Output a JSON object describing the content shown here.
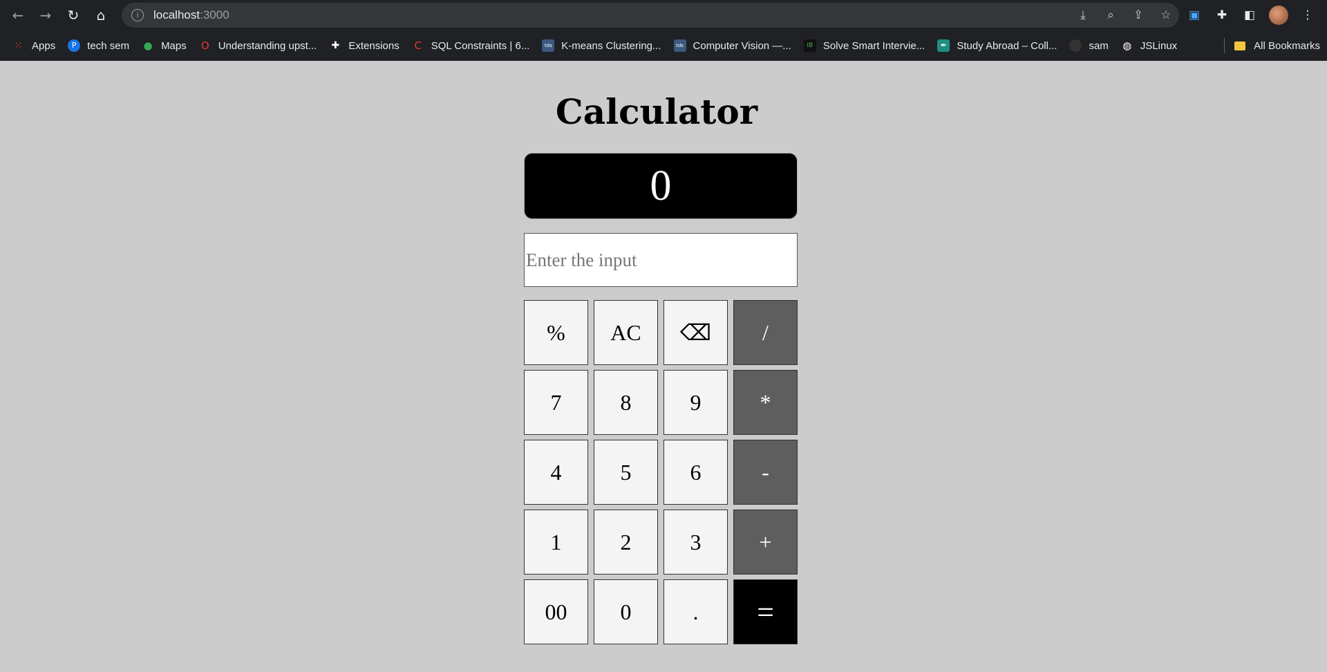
{
  "browser": {
    "url_host": "localhost",
    "url_port": ":3000",
    "bookmarks": [
      {
        "label": "Apps",
        "icon": "apps-grid-icon"
      },
      {
        "label": "tech sem",
        "icon": "p-logo-icon"
      },
      {
        "label": "Maps",
        "icon": "maps-pin-icon"
      },
      {
        "label": "Understanding upst...",
        "icon": "red-o-icon"
      },
      {
        "label": "Extensions",
        "icon": "puzzle-icon"
      },
      {
        "label": "SQL Constraints | 6...",
        "icon": "red-c-icon"
      },
      {
        "label": "K-means Clustering...",
        "icon": "tds-icon"
      },
      {
        "label": "Computer Vision —...",
        "icon": "tds-icon"
      },
      {
        "label": "Solve Smart Intervie...",
        "icon": "ib-icon"
      },
      {
        "label": "Study Abroad – Coll...",
        "icon": "pen-nib-icon"
      },
      {
        "label": "sam",
        "icon": "github-icon"
      },
      {
        "label": "JSLinux",
        "icon": "globe-icon"
      }
    ],
    "all_bookmarks": "All Bookmarks"
  },
  "calculator": {
    "title": "Calculator",
    "display_value": "0",
    "input_placeholder": "Enter the input",
    "keys": [
      {
        "label": "%",
        "kind": "num"
      },
      {
        "label": "AC",
        "kind": "num"
      },
      {
        "label": "⌫",
        "kind": "num"
      },
      {
        "label": "/",
        "kind": "op"
      },
      {
        "label": "7",
        "kind": "num"
      },
      {
        "label": "8",
        "kind": "num"
      },
      {
        "label": "9",
        "kind": "num"
      },
      {
        "label": "*",
        "kind": "op"
      },
      {
        "label": "4",
        "kind": "num"
      },
      {
        "label": "5",
        "kind": "num"
      },
      {
        "label": "6",
        "kind": "num"
      },
      {
        "label": "-",
        "kind": "op"
      },
      {
        "label": "1",
        "kind": "num"
      },
      {
        "label": "2",
        "kind": "num"
      },
      {
        "label": "3",
        "kind": "num"
      },
      {
        "label": "+",
        "kind": "op"
      },
      {
        "label": "00",
        "kind": "num"
      },
      {
        "label": "0",
        "kind": "num"
      },
      {
        "label": ".",
        "kind": "num"
      },
      {
        "label": "=",
        "kind": "eq"
      }
    ]
  },
  "colors": {
    "page_bg": "#cccccc",
    "display_bg": "#000000",
    "operator_key": "#5e5e5e",
    "equals_key": "#000000"
  }
}
